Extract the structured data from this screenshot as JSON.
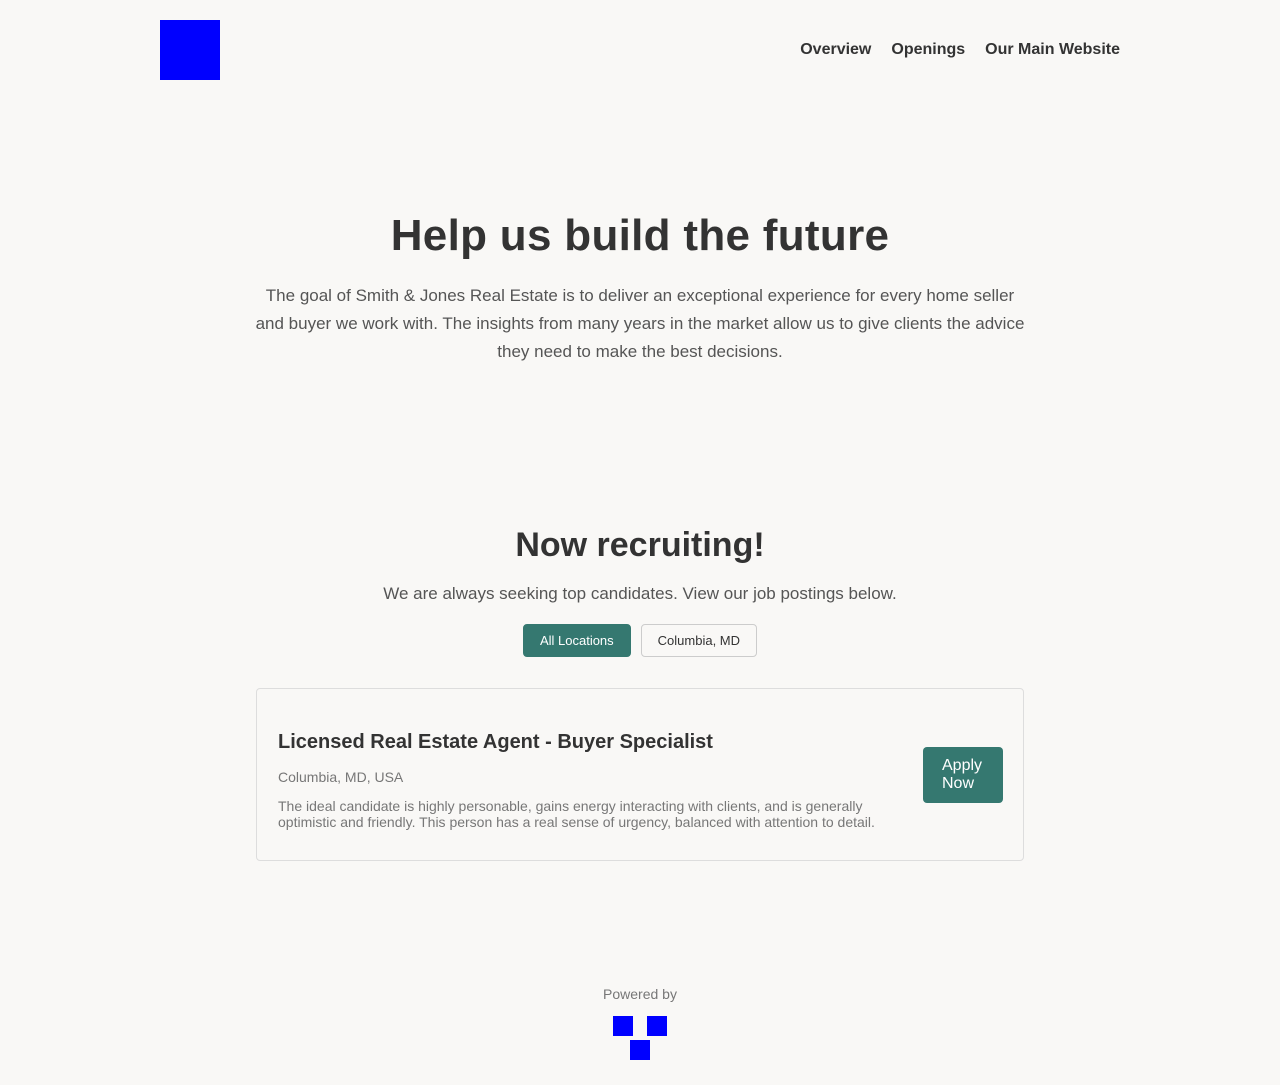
{
  "colors": {
    "background": "#f9f8f6",
    "accent": "#357870",
    "logo_placeholder": "#0000ff",
    "text_primary": "#333333",
    "text_muted": "#777777"
  },
  "header": {
    "logo_icon": "logo-placeholder",
    "nav": [
      {
        "label": "Overview"
      },
      {
        "label": "Openings"
      },
      {
        "label": "Our Main Website"
      }
    ]
  },
  "hero": {
    "title": "Help us build the future",
    "description": "The goal of Smith & Jones Real Estate is to deliver an exceptional experience for every home seller and buyer we work with. The insights from many years in the market allow us to give clients the advice they need to make the best decisions."
  },
  "recruit": {
    "title": "Now recruiting!",
    "subtitle": "We are always seeking top candidates. View our job postings below.",
    "filters": [
      {
        "label": "All Locations",
        "selected": true
      },
      {
        "label": "Columbia, MD",
        "selected": false
      }
    ]
  },
  "jobs": [
    {
      "title": "Licensed Real Estate Agent - Buyer Specialist",
      "location": "Columbia, MD, USA",
      "description": "The ideal candidate is highly personable, gains energy interacting with clients, and is generally optimistic and friendly. This person has a real sense of urgency, balanced with attention to detail.",
      "apply_label": "Apply Now"
    }
  ],
  "footer": {
    "powered_by": "Powered by",
    "logo_icon": "powered-by-logo"
  }
}
